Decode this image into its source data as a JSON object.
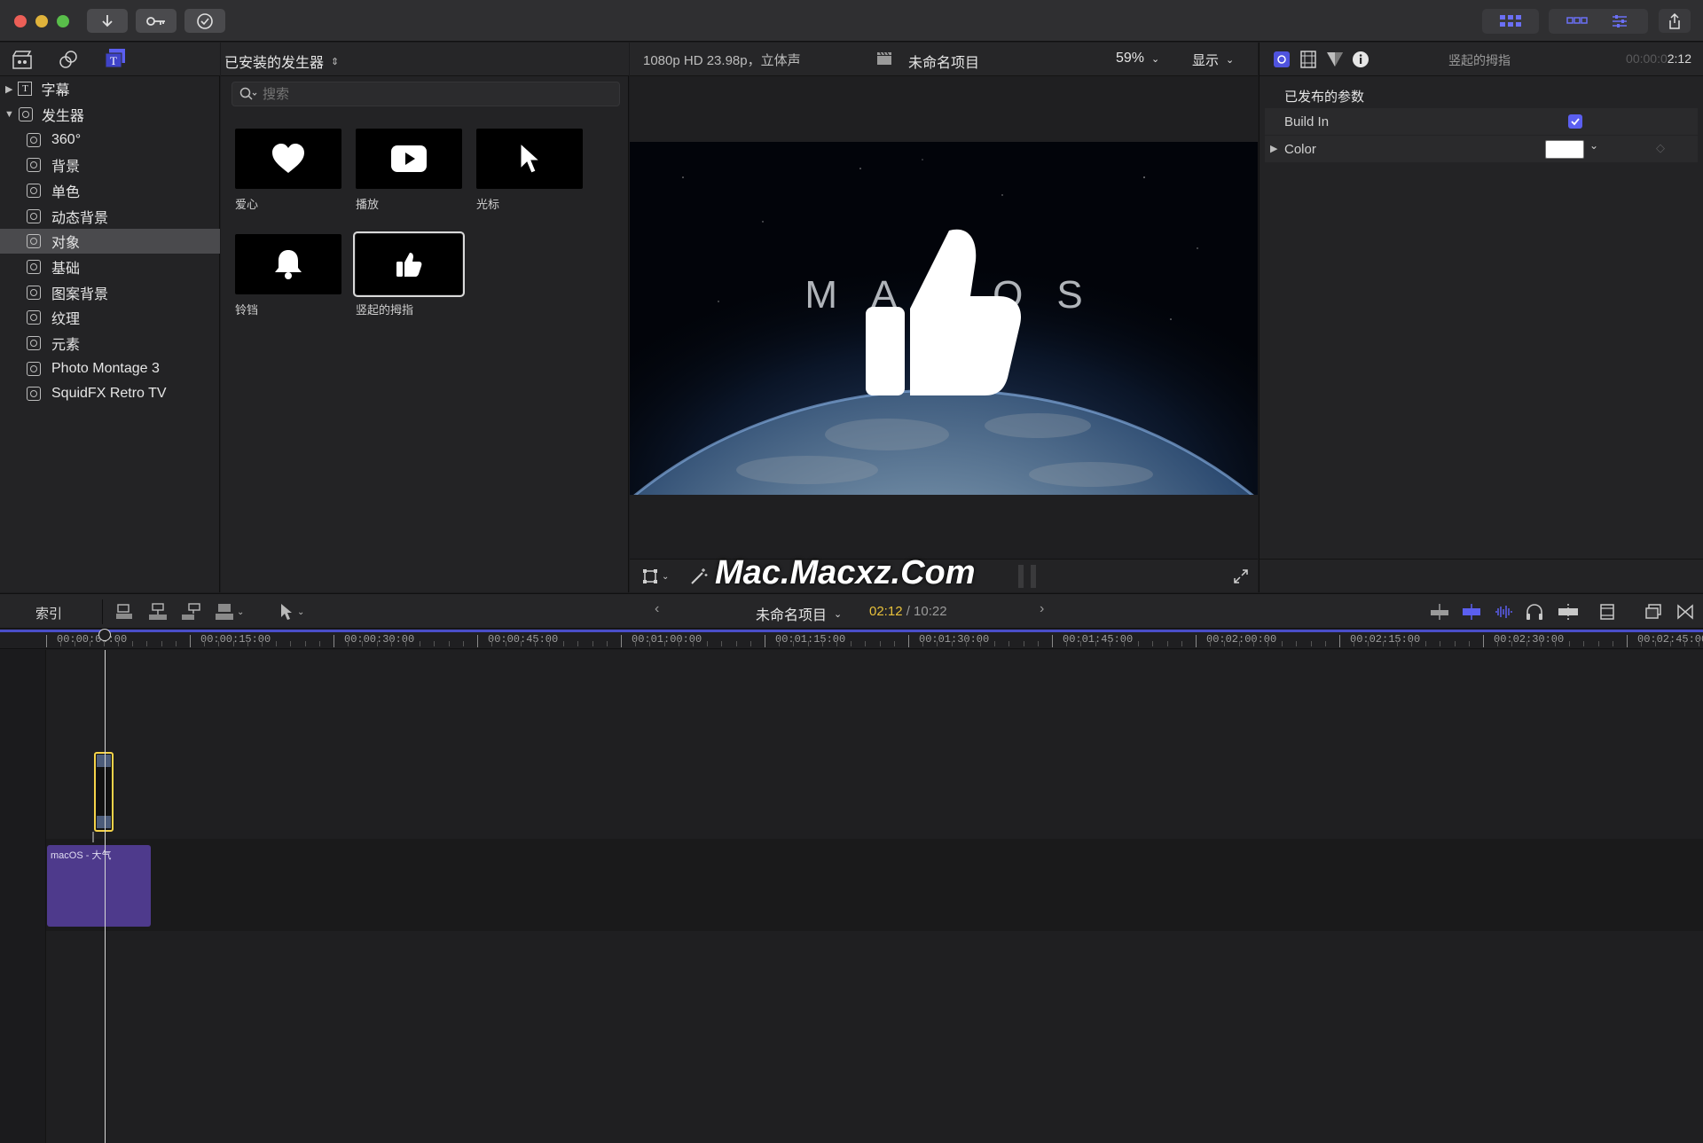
{
  "window": {
    "toolbar": {
      "import_icon": "down-arrow-icon",
      "keyword_icon": "key-icon",
      "check_icon": "checkmark-circle-icon"
    }
  },
  "browser_tabs": [
    "libraries-icon",
    "photos-audio-icon",
    "titles-generators-icon"
  ],
  "sidebar": {
    "items": [
      {
        "label": "字幕",
        "expanded": false
      },
      {
        "label": "发生器",
        "expanded": true
      },
      {
        "label": "360°"
      },
      {
        "label": "背景"
      },
      {
        "label": "单色"
      },
      {
        "label": "动态背景"
      },
      {
        "label": "对象",
        "selected": true
      },
      {
        "label": "基础"
      },
      {
        "label": "图案背景"
      },
      {
        "label": "纹理"
      },
      {
        "label": "元素"
      },
      {
        "label": "Photo Montage 3"
      },
      {
        "label": "SquidFX Retro TV"
      }
    ]
  },
  "browser": {
    "dropdown_label": "已安装的发生器",
    "search_placeholder": "搜索",
    "items": [
      {
        "label": "爱心",
        "icon": "heart-icon"
      },
      {
        "label": "播放",
        "icon": "play-icon"
      },
      {
        "label": "光标",
        "icon": "cursor-icon"
      },
      {
        "label": "铃铛",
        "icon": "bell-icon"
      },
      {
        "label": "竖起的拇指",
        "icon": "thumbs-up-icon",
        "selected": true
      }
    ]
  },
  "viewer": {
    "format": "1080p HD 23.98p，立体声",
    "project_name": "未命名项目",
    "zoom": "59%",
    "display_menu": "显示",
    "preview_text": "MACOS",
    "watermark": "Mac.Macxz.Com"
  },
  "inspector": {
    "title": "竖起的拇指",
    "timecode_dim": "00:00:0",
    "timecode_bright": "2:12",
    "section_title": "已发布的参数",
    "params": [
      {
        "label": "Build In",
        "type": "checkbox",
        "checked": true
      },
      {
        "label": "Color",
        "type": "color",
        "value": "#ffffff"
      }
    ]
  },
  "timeline": {
    "index_label": "索引",
    "project_name": "未命名项目",
    "current_time": "02:12",
    "total_time": "/ 10:22",
    "ruler_ticks": [
      "00:00:00:00",
      "00:00:15:00",
      "00:00:30:00",
      "00:00:45:00",
      "00:01:00:00",
      "00:01:15:00",
      "00:01:30:00",
      "00:01:45:00",
      "00:02:00:00",
      "00:02:15:00",
      "00:02:30:00",
      "00:02:45:00"
    ],
    "clip_label": "macOS - 大气"
  },
  "colors": {
    "accent": "#5b5ff0",
    "playhead": "#d8d8d8",
    "selection": "#f5d34a",
    "clip_purple": "#4e3a8c",
    "timecode_yellow": "#e8c13b"
  }
}
